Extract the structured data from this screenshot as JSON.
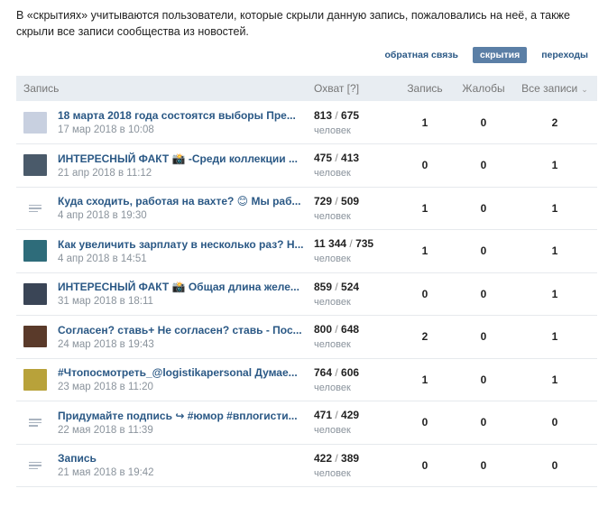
{
  "intro_text": "В «скрытиях» учитываются пользователи, которые скрыли данную запись, пожаловались на неё, а также скрыли все записи сообщества из новостей.",
  "tabs": [
    {
      "label": "обратная связь",
      "active": false
    },
    {
      "label": "скрытия",
      "active": true
    },
    {
      "label": "переходы",
      "active": false
    }
  ],
  "columns": {
    "post": "Запись",
    "reach": "Охват [?]",
    "post_hides": "Запись",
    "complaints": "Жалобы",
    "all_posts": "Все записи"
  },
  "reach_unit": "человек",
  "thumb_colors": [
    "#c8d0e0",
    "#4a5a6a",
    "none",
    "#2e6c7a",
    "#3a4556",
    "#5a3a2a",
    "#b8a23a",
    "none",
    "none"
  ],
  "rows": [
    {
      "title": "18 марта 2018 года состоятся выборы Пре...",
      "date": "17 мар 2018 в 10:08",
      "reach_a": "813",
      "reach_b": "675",
      "post": "1",
      "complaints": "0",
      "all": "2"
    },
    {
      "title": "ИНТЕРЕСНЫЙ ФАКТ 📸 -Среди коллекции ...",
      "date": "21 апр 2018 в 11:12",
      "reach_a": "475",
      "reach_b": "413",
      "post": "0",
      "complaints": "0",
      "all": "1"
    },
    {
      "title": "Куда сходить, работая на вахте? 😊 Мы раб...",
      "date": "4 апр 2018 в 19:30",
      "reach_a": "729",
      "reach_b": "509",
      "post": "1",
      "complaints": "0",
      "all": "1"
    },
    {
      "title": "Как увеличить зарплату в несколько раз? Н...",
      "date": "4 апр 2018 в 14:51",
      "reach_a": "11 344",
      "reach_b": "735",
      "post": "1",
      "complaints": "0",
      "all": "1"
    },
    {
      "title": "ИНТЕРЕСНЫЙ ФАКТ 📸 Общая длина желе...",
      "date": "31 мар 2018 в 18:11",
      "reach_a": "859",
      "reach_b": "524",
      "post": "0",
      "complaints": "0",
      "all": "1"
    },
    {
      "title": "Согласен? ставь+ Не согласен? ставь - Пос...",
      "date": "24 мар 2018 в 19:43",
      "reach_a": "800",
      "reach_b": "648",
      "post": "2",
      "complaints": "0",
      "all": "1"
    },
    {
      "title": "#Чтопосмотреть_@logistikapersonal Думае...",
      "date": "23 мар 2018 в 11:20",
      "reach_a": "764",
      "reach_b": "606",
      "post": "1",
      "complaints": "0",
      "all": "1"
    },
    {
      "title": "Придумайте подпись ↪ #юмор #вплогисти...",
      "date": "22 мая 2018 в 11:39",
      "reach_a": "471",
      "reach_b": "429",
      "post": "0",
      "complaints": "0",
      "all": "0"
    },
    {
      "title": "Запись",
      "date": "21 мая 2018 в 19:42",
      "reach_a": "422",
      "reach_b": "389",
      "post": "0",
      "complaints": "0",
      "all": "0"
    }
  ]
}
